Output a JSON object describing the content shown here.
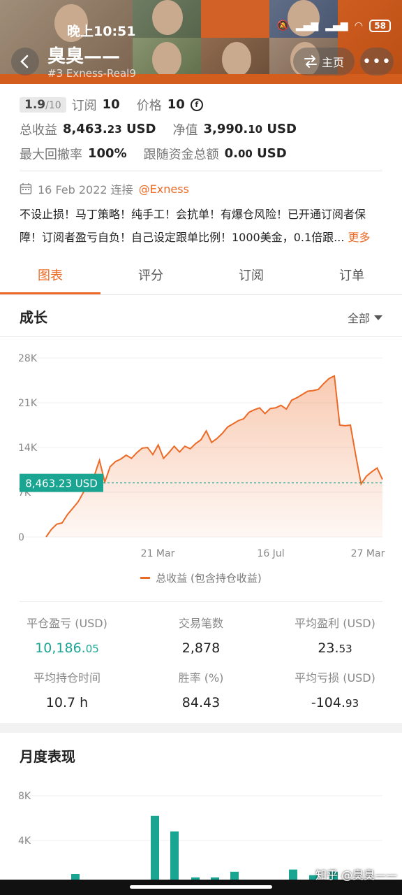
{
  "status_bar": {
    "time": "晚上10:51",
    "battery": "58"
  },
  "header": {
    "name": "臭臭——",
    "sub": "#3   Exness-Real9",
    "home_label": "主页",
    "more_label": "•••"
  },
  "stats": {
    "rating": "1.9",
    "rating_total": "/10",
    "subscribe_label": "订阅",
    "subscribe_value": "10",
    "price_label": "价格",
    "price_value": "10",
    "total_profit_label": "总收益",
    "total_profit_int": "8,463.",
    "total_profit_dec": "23",
    "total_profit_unit": "USD",
    "equity_label": "净值",
    "equity_int": "3,990.",
    "equity_dec": "10",
    "equity_unit": "USD",
    "drawdown_label": "最大回撤率",
    "drawdown_value": "100%",
    "follow_label": "跟随资金总额",
    "follow_int": "0.",
    "follow_dec": "00",
    "follow_unit": "USD"
  },
  "connect": {
    "date_text": "16 Feb 2022 连接",
    "broker": "@Exness"
  },
  "description": {
    "line1": "不设止损！马丁策略！纯手工！会抗单！有爆仓风险！已开通订阅者保",
    "line2": "障！订阅者盈亏自负！自己设定跟单比例！1000美金，0.1倍跟...",
    "more": "更多"
  },
  "tabs": [
    "图表",
    "评分",
    "订阅",
    "订单"
  ],
  "growth": {
    "title": "成长",
    "range": "全部",
    "legend": "总收益 (包含持仓收益)"
  },
  "colors": {
    "accent": "#ec6a26",
    "green": "#1aa593"
  },
  "chart_data": {
    "type": "area",
    "yticks": [
      "28K",
      "21K",
      "14K",
      "7K",
      "0"
    ],
    "ylim": [
      0,
      28000
    ],
    "xticks": [
      "21 Mar",
      "16 Jul",
      "27 Mar"
    ],
    "marker_label": "8,463.23 USD",
    "marker_value": 8463.23,
    "series": [
      {
        "values": [
          0,
          1200,
          2000,
          2200,
          3500,
          4500,
          5500,
          7000,
          8300,
          9500,
          12000,
          8600,
          11000,
          11800,
          12200,
          12800,
          12300,
          13200,
          13900,
          14000,
          12900,
          14400,
          12300,
          13200,
          14200,
          13300,
          14200,
          13800,
          14600,
          15200,
          16600,
          14800,
          15400,
          16200,
          17200,
          17700,
          18200,
          18500,
          19500,
          19900,
          20200,
          19300,
          20100,
          20200,
          20600,
          20000,
          21400,
          21800,
          22300,
          22800,
          22900,
          23100,
          24000,
          24800,
          25200,
          17500,
          17400,
          17500,
          12800,
          8300,
          9500,
          10200,
          10800,
          9000
        ]
      }
    ]
  },
  "metrics": [
    {
      "label": "平仓盈亏 (USD)",
      "int": "10,186.",
      "dec": "05",
      "green": true
    },
    {
      "label": "交易笔数",
      "int": "2,878",
      "dec": "",
      "green": false
    },
    {
      "label": "平均盈利 (USD)",
      "int": "23.",
      "dec": "53",
      "green": false
    },
    {
      "label": "平均持仓时间",
      "int": "10.7 h",
      "dec": "",
      "green": false
    },
    {
      "label": "胜率 (%)",
      "int": "84.43",
      "dec": "",
      "green": false
    },
    {
      "label": "平均亏损 (USD)",
      "int": "-104.",
      "dec": "93",
      "green": false
    }
  ],
  "monthly": {
    "title": "月度表现",
    "chart_data": {
      "type": "bar",
      "yticks": [
        "8K",
        "4K"
      ],
      "ylim": [
        0,
        8000
      ],
      "values": [
        1000,
        0,
        0,
        0,
        6200,
        4800,
        700,
        700,
        1200,
        0,
        0,
        1400,
        900,
        1200
      ]
    }
  },
  "watermark": "知乎 @臭臭——"
}
